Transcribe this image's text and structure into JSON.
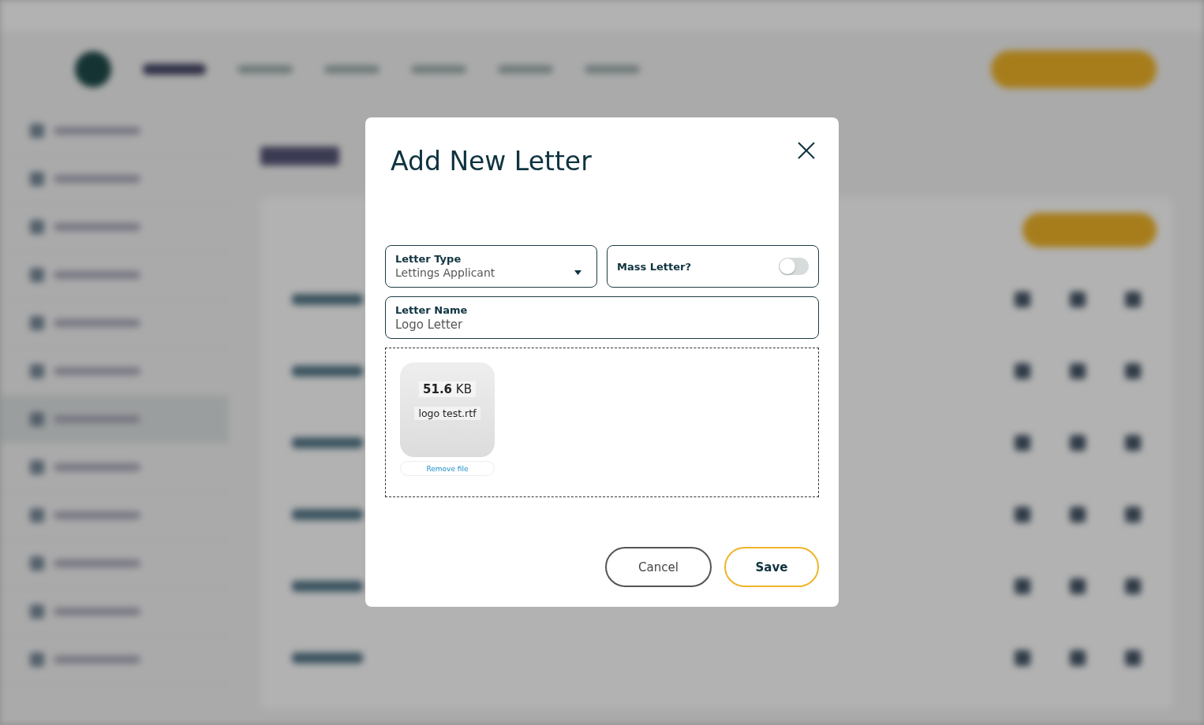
{
  "dialog": {
    "title": "Add New Letter",
    "letter_type": {
      "label": "Letter Type",
      "value": "Lettings Applicant"
    },
    "mass_letter": {
      "label": "Mass Letter?",
      "on": false
    },
    "letter_name": {
      "label": "Letter Name",
      "value": "Logo Letter"
    },
    "file": {
      "size": "**51.6** KB",
      "name": "logo test.rtf",
      "remove": "Remove file"
    },
    "buttons": [
      {
        "label": "Cancel",
        "kind": "secondary"
      },
      {
        "label": "Save",
        "kind": "primary"
      }
    ]
  }
}
